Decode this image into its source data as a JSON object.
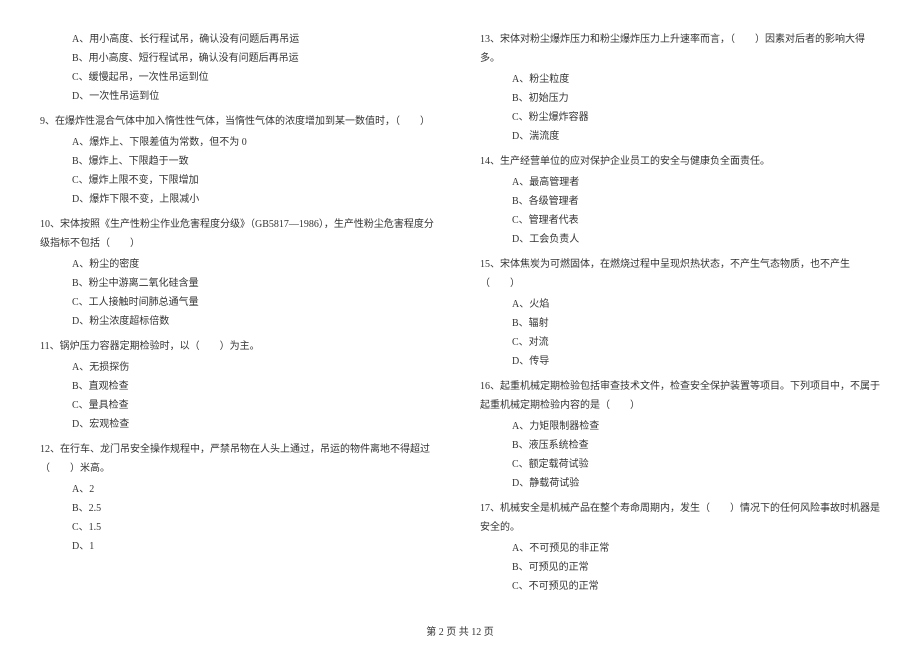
{
  "q8_continued": {
    "options": [
      "A、用小高度、长行程试吊，确认没有问题后再吊运",
      "B、用小高度、短行程试吊，确认没有问题后再吊运",
      "C、缓慢起吊，一次性吊运到位",
      "D、一次性吊运到位"
    ]
  },
  "q9": {
    "text": "9、在爆炸性混合气体中加入惰性性气体，当惰性气体的浓度增加到某一数值时，（　　）",
    "options": [
      "A、爆炸上、下限差值为常数，但不为 0",
      "B、爆炸上、下限趋于一致",
      "C、爆炸上限不变，下限增加",
      "D、爆炸下限不变，上限减小"
    ]
  },
  "q10": {
    "text": "10、宋体按照《生产性粉尘作业危害程度分级》（GB5817—1986），生产性粉尘危害程度分级指标不包括（　　）",
    "options": [
      "A、粉尘的密度",
      "B、粉尘中游离二氧化硅含量",
      "C、工人接触时间肺总通气量",
      "D、粉尘浓度超标倍数"
    ]
  },
  "q11": {
    "text": "11、锅炉压力容器定期检验时，以（　　）为主。",
    "options": [
      "A、无损探伤",
      "B、直观检查",
      "C、量具检查",
      "D、宏观检查"
    ]
  },
  "q12": {
    "text": "12、在行车、龙门吊安全操作规程中，严禁吊物在人头上通过，吊运的物件离地不得超过（　　）米高。",
    "options": [
      "A、2",
      "B、2.5",
      "C、1.5",
      "D、1"
    ]
  },
  "q13": {
    "text": "13、宋体对粉尘爆炸压力和粉尘爆炸压力上升速率而言，（　　）因素对后者的影响大得多。",
    "options": [
      "A、粉尘粒度",
      "B、初始压力",
      "C、粉尘爆炸容器",
      "D、湍流度"
    ]
  },
  "q14": {
    "text": "14、生产经营单位的应对保护企业员工的安全与健康负全面责任。",
    "options": [
      "A、最高管理者",
      "B、各级管理者",
      "C、管理者代表",
      "D、工会负责人"
    ]
  },
  "q15": {
    "text": "15、宋体焦炭为可燃固体，在燃烧过程中呈现炽热状态，不产生气态物质，也不产生（　　）",
    "options": [
      "A、火焰",
      "B、辐射",
      "C、对流",
      "D、传导"
    ]
  },
  "q16": {
    "text": "16、起重机械定期检验包括审查技术文件，检查安全保护装置等项目。下列项目中，不属于起重机械定期检验内容的是（　　）",
    "options": [
      "A、力矩限制器检查",
      "B、液压系统检查",
      "C、额定载荷试验",
      "D、静载荷试验"
    ]
  },
  "q17": {
    "text": "17、机械安全是机械产品在整个寿命周期内，发生（　　）情况下的任何风险事故时机器是安全的。",
    "options": [
      "A、不可预见的非正常",
      "B、可预见的正常",
      "C、不可预见的正常"
    ]
  },
  "footer": "第 2 页 共 12 页"
}
